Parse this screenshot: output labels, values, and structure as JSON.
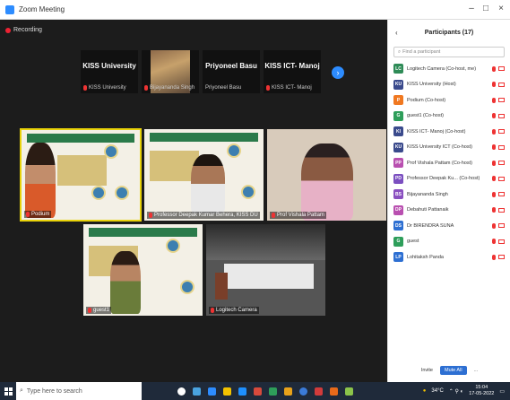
{
  "window": {
    "title": "Zoom Meeting",
    "recording_label": "Recording"
  },
  "strip": [
    {
      "name": "KISS University",
      "sub": "KISS University"
    },
    {
      "name": "",
      "sub": "Bijayananda Singh"
    },
    {
      "name": "Priyoneel Basu",
      "sub": "Priyoneel Basu"
    },
    {
      "name": "KISS ICT- Manoj",
      "sub": "KISS ICT- Manoj"
    }
  ],
  "gallery": [
    {
      "label": "Podium"
    },
    {
      "label": "Professor Deepak Kumar Behera, KISS DU"
    },
    {
      "label": "Prof Vishala Pattam"
    },
    {
      "label": "guest1"
    },
    {
      "label": "Logitech Camera"
    }
  ],
  "participants": {
    "title": "Participants (17)",
    "search_placeholder": "Find a participant",
    "list": [
      {
        "initials": "LC",
        "color": "#2e8b57",
        "name": "Logitech Camera (Co-host, me)"
      },
      {
        "initials": "KU",
        "color": "#3a4a8c",
        "name": "KISS University (Host)"
      },
      {
        "initials": "P",
        "color": "#f07820",
        "name": "Podium (Co-host)"
      },
      {
        "initials": "G",
        "color": "#2e9e5a",
        "name": "guest1 (Co-host)"
      },
      {
        "initials": "KI",
        "color": "#3a4a8c",
        "name": "KISS ICT- Manoj (Co-host)"
      },
      {
        "initials": "KU",
        "color": "#3a4a8c",
        "name": "KISS University ICT (Co-host)"
      },
      {
        "initials": "PP",
        "color": "#b94fb0",
        "name": "Prof Vishala Pattam (Co-host)"
      },
      {
        "initials": "PD",
        "color": "#7b4fc0",
        "name": "Professor Deepak Ku... (Co-host)"
      },
      {
        "initials": "BS",
        "color": "#8a4fc0",
        "name": "Bijayananda Singh"
      },
      {
        "initials": "DP",
        "color": "#b94fb0",
        "name": "Debahuti Pattanaik"
      },
      {
        "initials": "DS",
        "color": "#2d6fd2",
        "name": "Dr BIRENDRA SUNA"
      },
      {
        "initials": "G",
        "color": "#2e9e5a",
        "name": "guest"
      },
      {
        "initials": "LP",
        "color": "#2d6fd2",
        "name": "Lohitaksh Panda"
      }
    ],
    "invite_label": "Invite",
    "mute_all_label": "Mute All",
    "more_label": "..."
  },
  "taskbar": {
    "search_placeholder": "Type here to search",
    "weather": "34°C",
    "time": "15:04",
    "date": "17-05-2022"
  }
}
